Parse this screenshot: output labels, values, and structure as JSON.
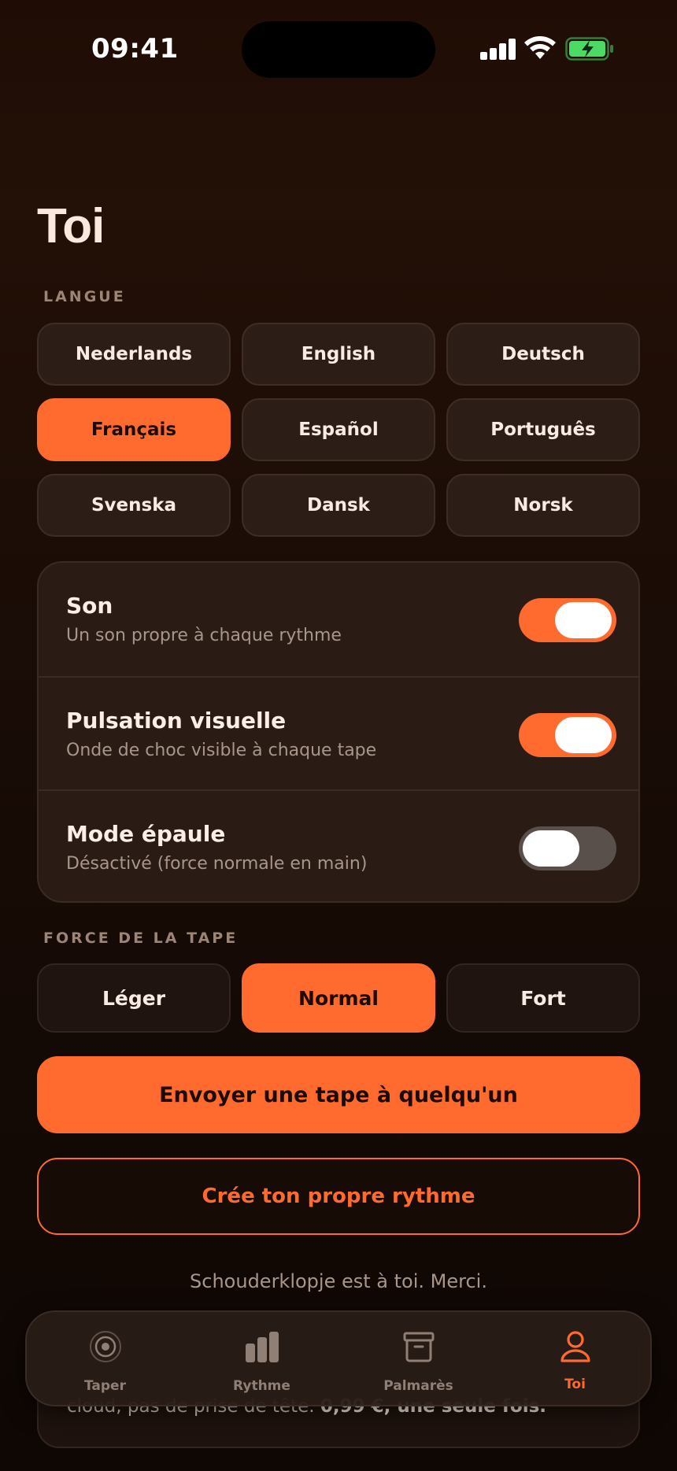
{
  "status_bar": {
    "time": "09:41"
  },
  "page": {
    "title": "Toi"
  },
  "language": {
    "section_label": "LANGUE",
    "options": [
      {
        "label": "Nederlands",
        "selected": false
      },
      {
        "label": "English",
        "selected": false
      },
      {
        "label": "Deutsch",
        "selected": false
      },
      {
        "label": "Français",
        "selected": true
      },
      {
        "label": "Español",
        "selected": false
      },
      {
        "label": "Português",
        "selected": false
      },
      {
        "label": "Svenska",
        "selected": false
      },
      {
        "label": "Dansk",
        "selected": false
      },
      {
        "label": "Norsk",
        "selected": false
      }
    ]
  },
  "settings": [
    {
      "title": "Son",
      "subtitle": "Un son propre à chaque rythme",
      "enabled": true
    },
    {
      "title": "Pulsation visuelle",
      "subtitle": "Onde de choc visible à chaque tape",
      "enabled": true
    },
    {
      "title": "Mode épaule",
      "subtitle": "Désactivé (force normale en main)",
      "enabled": false
    }
  ],
  "force": {
    "section_label": "FORCE DE LA TAPE",
    "options": [
      {
        "label": "Léger",
        "selected": false
      },
      {
        "label": "Normal",
        "selected": true
      },
      {
        "label": "Fort",
        "selected": false
      }
    ]
  },
  "actions": {
    "send_tap": "Envoyer une tape à quelqu'un",
    "create_rhythm": "Crée ton propre rythme"
  },
  "footer_note": "Schouderklopje est à toi. Merci.",
  "partial_card": {
    "text": "cloud, pas de prise de tête.",
    "price": "0,99 €, une seule fois."
  },
  "tabs": [
    {
      "label": "Taper",
      "icon": "target-icon",
      "active": false
    },
    {
      "label": "Rythme",
      "icon": "bars-icon",
      "active": false
    },
    {
      "label": "Palmarès",
      "icon": "archive-box-icon",
      "active": false
    },
    {
      "label": "Toi",
      "icon": "person-icon",
      "active": true
    }
  ],
  "colors": {
    "accent": "#ff6a2e",
    "background": "#1c0d06",
    "card": "#2a1c15",
    "toggle_off": "#5a504b",
    "battery_green": "#4cd964"
  }
}
